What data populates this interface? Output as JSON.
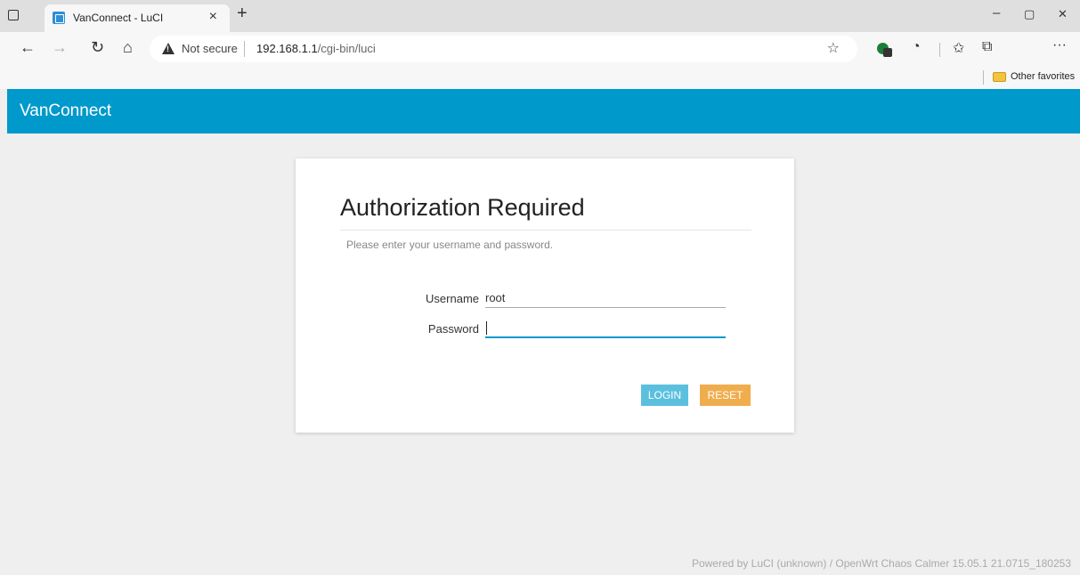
{
  "browser": {
    "tab_title": "VanConnect - LuCI",
    "tab_close": "×",
    "new_tab": "+",
    "security_label": "Not secure",
    "url_host": "192.168.1.1",
    "url_path": "/cgi-bin/luci",
    "favorites_label": "Other favorites",
    "window_controls": {
      "minimize": "–",
      "restore": "▢",
      "close": "✕"
    },
    "nav": {
      "back": "←",
      "forward": "→",
      "reload": "↻",
      "home": "⌂"
    },
    "toolbar_icons": {
      "favorites": "☆",
      "collections": "✩",
      "share": "⧉",
      "menu": "···",
      "extension": "◔"
    }
  },
  "app": {
    "brand": "VanConnect"
  },
  "login": {
    "title": "Authorization Required",
    "description": "Please enter your username and password.",
    "username_label": "Username",
    "username_value": "root",
    "password_label": "Password",
    "password_value": "",
    "login_button": "LOGIN",
    "reset_button": "RESET"
  },
  "footer": {
    "text": "Powered by LuCI (unknown) / OpenWrt Chaos Calmer 15.05.1 21.0715_180253"
  },
  "colors": {
    "header": "#0099cc",
    "login_button": "#5bc0de",
    "reset_button": "#f0ad4e",
    "background": "#efefef"
  }
}
